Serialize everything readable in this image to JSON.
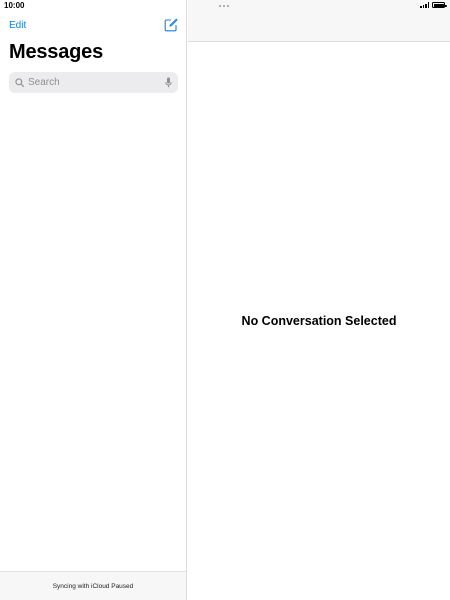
{
  "status_bar": {
    "time": "10:00",
    "signal_bars": 4,
    "battery_level": 1.0
  },
  "sidebar": {
    "edit_label": "Edit",
    "title": "Messages",
    "search": {
      "placeholder": "Search",
      "value": ""
    },
    "sync_status": "Syncing with iCloud Paused"
  },
  "detail": {
    "empty_message": "No Conversation Selected"
  },
  "colors": {
    "accent": "#1a7ee0",
    "search_bg": "#ececee",
    "bar_bg": "#f7f7f7"
  },
  "icons": [
    "compose-icon",
    "search-icon",
    "microphone-icon",
    "multitasking-dots-icon",
    "signal-icon",
    "battery-icon"
  ]
}
